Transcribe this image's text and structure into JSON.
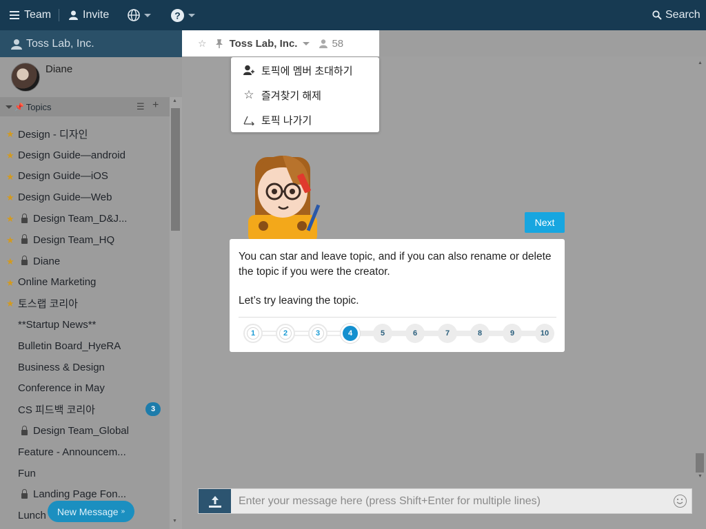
{
  "topbar": {
    "team_label": "Team",
    "invite_label": "Invite",
    "search_label": "Search"
  },
  "sidebar": {
    "team_name": "Toss Lab, Inc.",
    "profile_name": "Diane",
    "topics_label": "Topics",
    "topics": [
      {
        "label": "Design - 디자인",
        "starred": true,
        "locked": false
      },
      {
        "label": "Design Guide—android",
        "starred": true,
        "locked": false
      },
      {
        "label": "Design Guide—iOS",
        "starred": true,
        "locked": false
      },
      {
        "label": "Design Guide—Web",
        "starred": true,
        "locked": false
      },
      {
        "label": "Design Team_D&J...",
        "starred": true,
        "locked": true
      },
      {
        "label": "Design Team_HQ",
        "starred": true,
        "locked": true
      },
      {
        "label": "Diane",
        "starred": true,
        "locked": true
      },
      {
        "label": "Online Marketing",
        "starred": true,
        "locked": false
      },
      {
        "label": "토스랩 코리아",
        "starred": true,
        "locked": false
      },
      {
        "label": "**Startup News**",
        "starred": false,
        "locked": false
      },
      {
        "label": "Bulletin Board_HyeRA",
        "starred": false,
        "locked": false
      },
      {
        "label": "Business & Design",
        "starred": false,
        "locked": false
      },
      {
        "label": "Conference in May",
        "starred": false,
        "locked": false
      },
      {
        "label": "CS 피드백 코리아",
        "starred": false,
        "locked": false,
        "badge": "3"
      },
      {
        "label": "Design Team_Global",
        "starred": false,
        "locked": true
      },
      {
        "label": "Feature - Announcem...",
        "starred": false,
        "locked": false
      },
      {
        "label": "Fun",
        "starred": false,
        "locked": false
      },
      {
        "label": "Landing Page Fon...",
        "starred": false,
        "locked": true
      },
      {
        "label": "Lunch",
        "starred": false,
        "locked": false
      }
    ],
    "new_message_label": "New Message"
  },
  "topic_header": {
    "name": "Toss Lab, Inc.",
    "member_count": "58"
  },
  "dropdown": {
    "items": [
      {
        "label": "토픽에 멤버 초대하기",
        "icon": "add-member-icon"
      },
      {
        "label": "즐겨찾기 해제",
        "icon": "star-outline-icon"
      },
      {
        "label": "토픽 나가기",
        "icon": "leave-icon"
      }
    ]
  },
  "tour": {
    "next_label": "Next",
    "text1": "You can star and leave topic, and if you can also rename or delete the topic if you were the creator.",
    "text2": "Let’s try leaving the topic.",
    "steps": [
      "1",
      "2",
      "3",
      "4",
      "5",
      "6",
      "7",
      "8",
      "9",
      "10"
    ],
    "current_step": 4
  },
  "composer": {
    "placeholder": "Enter your message here (press Shift+Enter for multiple lines)"
  },
  "colors": {
    "topbar": "#173a52",
    "accent": "#17a6e0",
    "star": "#d39a1e"
  }
}
